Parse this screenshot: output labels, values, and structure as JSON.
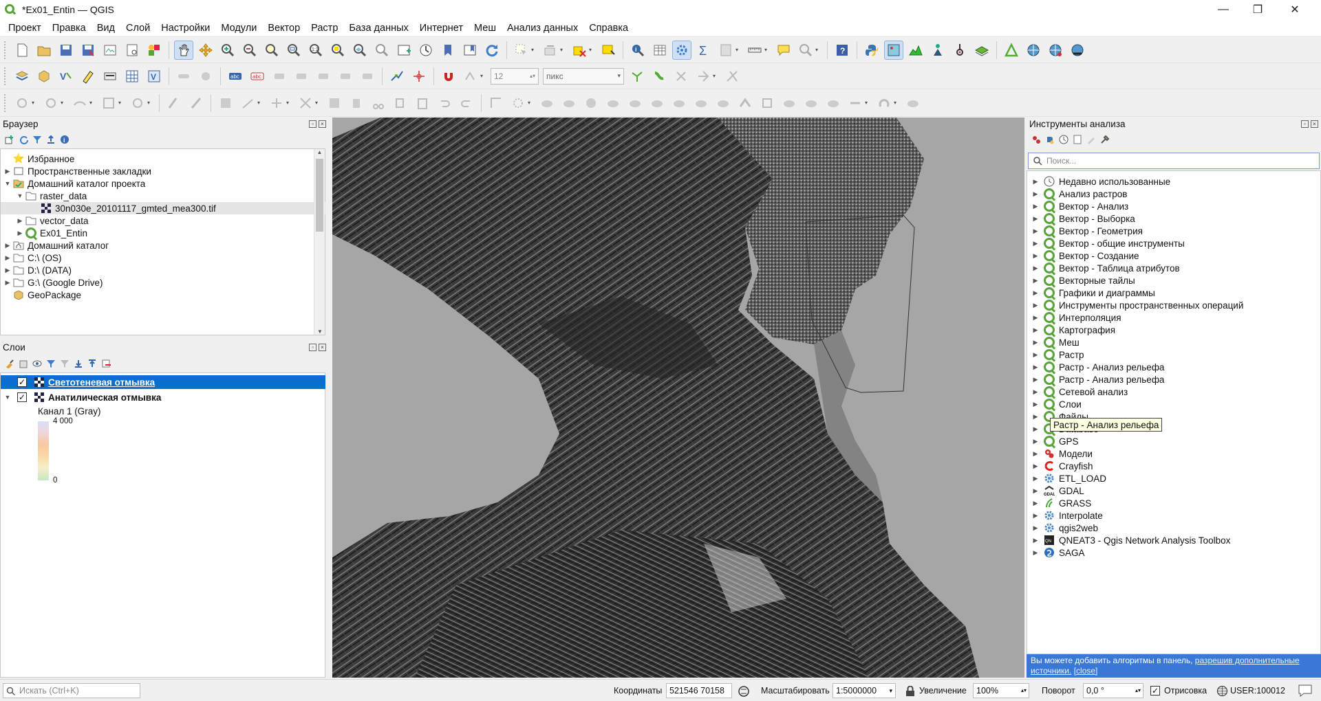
{
  "window": {
    "title": "*Ex01_Entin — QGIS",
    "minimize": "—",
    "maximize": "❐",
    "close": "✕"
  },
  "menu": [
    "Проект",
    "Правка",
    "Вид",
    "Слой",
    "Настройки",
    "Модули",
    "Вектор",
    "Растр",
    "База данных",
    "Интернет",
    "Меш",
    "Анализ данных",
    "Справка"
  ],
  "toolbar": {
    "label_size_value": "12",
    "label_unit": "пикс"
  },
  "browser": {
    "title": "Браузер",
    "items": [
      {
        "label": "Избранное"
      },
      {
        "label": "Пространственные закладки"
      },
      {
        "label": "Домашний каталог проекта"
      },
      {
        "label": "raster_data"
      },
      {
        "label": "30n030e_20101117_gmted_mea300.tif"
      },
      {
        "label": "vector_data"
      },
      {
        "label": "Ex01_Entin"
      },
      {
        "label": "Домашний каталог"
      },
      {
        "label": "C:\\ (OS)"
      },
      {
        "label": "D:\\ (DATA)"
      },
      {
        "label": "G:\\ (Google Drive)"
      },
      {
        "label": "GeoPackage"
      }
    ]
  },
  "layers": {
    "title": "Слои",
    "items": [
      {
        "label": "Светотеневая отмывка",
        "checked": true,
        "selected": true
      },
      {
        "label": "Анатилическая отмывка",
        "checked": true,
        "selected": false
      }
    ],
    "band_label": "Канал 1 (Gray)",
    "legend_max": "4 000",
    "legend_min": "0"
  },
  "processing": {
    "title": "Инструменты анализа",
    "search_placeholder": "Поиск...",
    "items": [
      {
        "label": "Недавно использованные",
        "icon": "clock-icon"
      },
      {
        "label": "Анализ растров",
        "icon": "qgis-icon"
      },
      {
        "label": "Вектор - Анализ",
        "icon": "qgis-icon"
      },
      {
        "label": "Вектор - Выборка",
        "icon": "qgis-icon"
      },
      {
        "label": "Вектор - Геометрия",
        "icon": "qgis-icon"
      },
      {
        "label": "Вектор - общие инструменты",
        "icon": "qgis-icon"
      },
      {
        "label": "Вектор - Создание",
        "icon": "qgis-icon"
      },
      {
        "label": "Вектор - Таблица атрибутов",
        "icon": "qgis-icon"
      },
      {
        "label": "Векторные тайлы",
        "icon": "qgis-icon"
      },
      {
        "label": "Графики и диаграммы",
        "icon": "qgis-icon"
      },
      {
        "label": "Инструменты пространственных операций",
        "icon": "qgis-icon"
      },
      {
        "label": "Интерполяция",
        "icon": "qgis-icon"
      },
      {
        "label": "Картография",
        "icon": "qgis-icon"
      },
      {
        "label": "Меш",
        "icon": "qgis-icon"
      },
      {
        "label": "Растр",
        "icon": "qgis-icon"
      },
      {
        "label": "Растр - Анализ рельефа",
        "icon": "qgis-icon"
      },
      {
        "label": "Растр - Анализ рельефа",
        "icon": "qgis-icon"
      },
      {
        "label": "Сетевой анализ",
        "icon": "qgis-icon"
      },
      {
        "label": "Слои",
        "icon": "qgis-icon"
      },
      {
        "label": "Файлы",
        "icon": "qgis-icon"
      },
      {
        "label": "Database",
        "icon": "qgis-icon"
      },
      {
        "label": "GPS",
        "icon": "qgis-icon"
      },
      {
        "label": "Модели",
        "icon": "model-gears-icon"
      },
      {
        "label": "Crayfish",
        "icon": "crayfish-icon"
      },
      {
        "label": "ETL_LOAD",
        "icon": "gear-icon"
      },
      {
        "label": "GDAL",
        "icon": "gdal-icon"
      },
      {
        "label": "GRASS",
        "icon": "grass-icon"
      },
      {
        "label": "Interpolate",
        "icon": "gear-icon"
      },
      {
        "label": "qgis2web",
        "icon": "gear-icon"
      },
      {
        "label": "QNEAT3 - Qgis Network Analysis Toolbox",
        "icon": "qneat-icon"
      },
      {
        "label": "SAGA",
        "icon": "saga-icon"
      }
    ],
    "tooltip": "Растр - Анализ рельефа",
    "info_text": "Вы можете добавить алгоритмы в панель, ",
    "info_link": "разрешив дополнительные источники.",
    "info_close": "[close]"
  },
  "status": {
    "search_placeholder": "Искать (Ctrl+K)",
    "coord_label": "Координаты",
    "coord_value": "521546 70158",
    "scale_label": "Масштабировать",
    "scale_value": "1:5000000",
    "zoom_label": "Увеличение",
    "zoom_value": "100%",
    "rotation_label": "Поворот",
    "rotation_value": "0,0 °",
    "render_label": "Отрисовка",
    "crs": "USER:100012"
  },
  "colors": {
    "accent": "#0078d7",
    "selection": "#3b78d8",
    "qgis_green": "#5aa33b",
    "info_bg": "#3a78d8"
  }
}
